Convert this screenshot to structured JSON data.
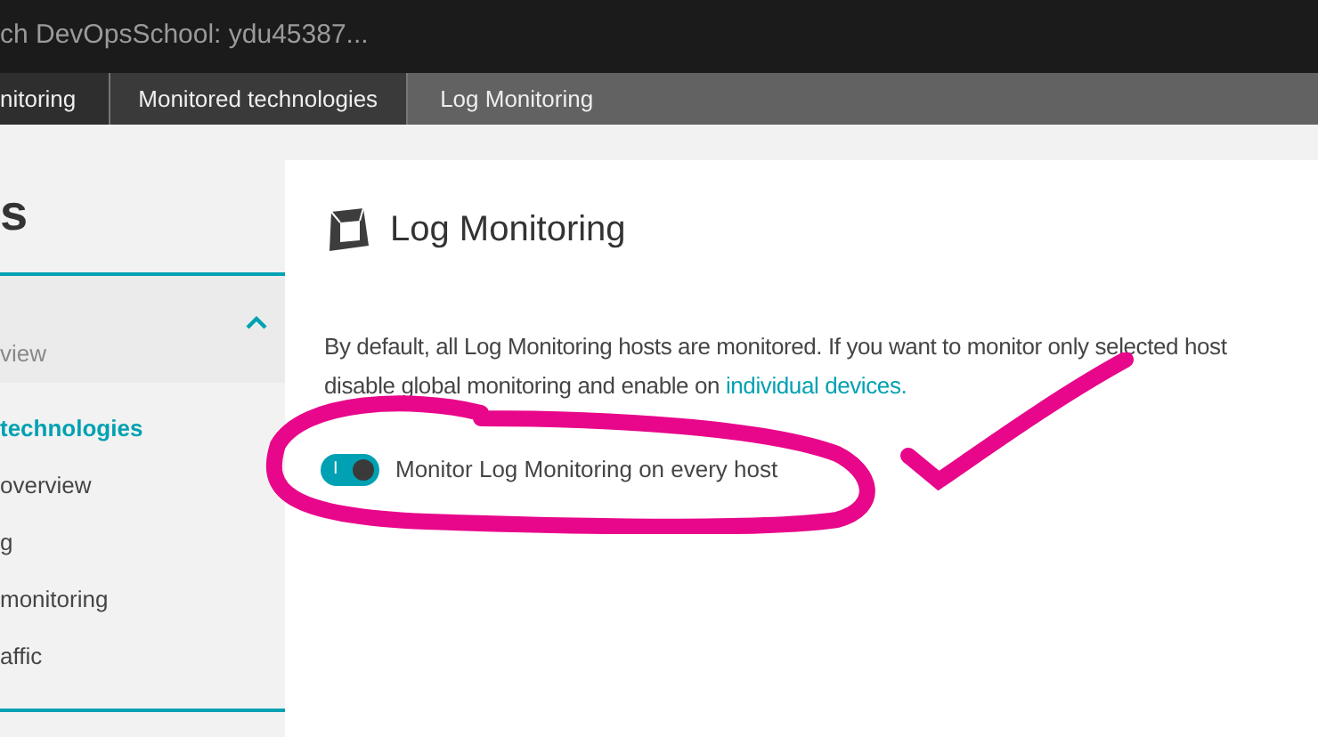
{
  "window": {
    "title": "ch DevOpsSchool: ydu45387..."
  },
  "breadcrumbs": [
    {
      "label": "nitoring",
      "selected": false
    },
    {
      "label": "Monitored technologies",
      "selected": false
    },
    {
      "label": "Log Monitoring",
      "selected": true
    }
  ],
  "sidebar": {
    "title": "s",
    "section": {
      "label": "view",
      "expanded": true
    },
    "items": [
      {
        "label": "technologies",
        "selected": true
      },
      {
        "label": "overview",
        "selected": false
      },
      {
        "label": "g",
        "selected": false
      },
      {
        "label": "monitoring",
        "selected": false
      },
      {
        "label": "affic",
        "selected": false
      }
    ]
  },
  "main": {
    "title": "Log Monitoring",
    "description": {
      "line_1": "By default, all Log Monitoring hosts are monitored. If you want to monitor only selected host",
      "line_2": "disable global monitoring and enable on ",
      "link": "individual devices."
    },
    "toggle": {
      "label": "Monitor Log Monitoring on every host",
      "glyph": "I",
      "on": true
    }
  }
}
